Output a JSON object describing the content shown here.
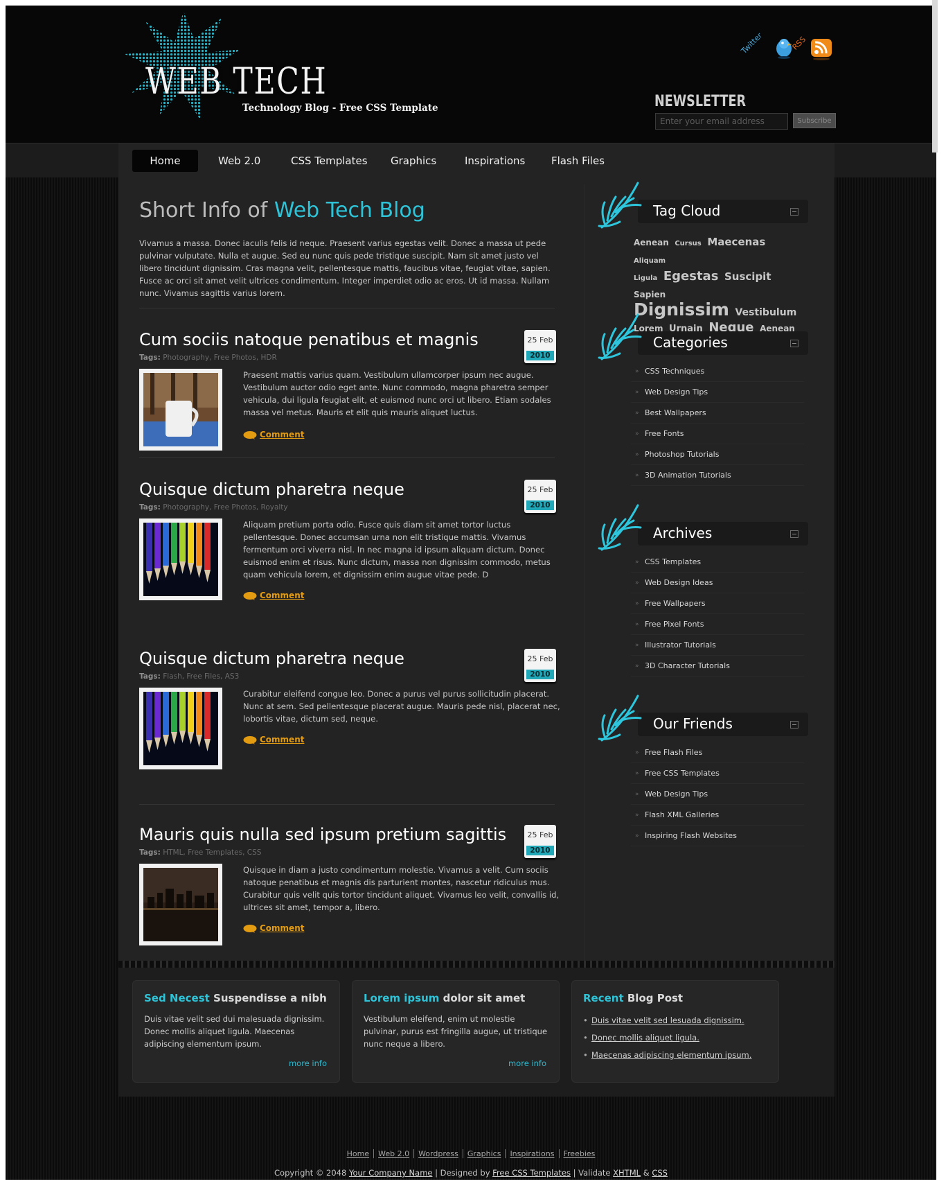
{
  "header": {
    "logo_title": "WEB TECH",
    "logo_subtitle": "Technology Blog - Free CSS Template",
    "social": {
      "twitter_label": "Twitter",
      "rss_label": "RSS"
    },
    "newsletter": {
      "title": "NEWSLETTER",
      "placeholder": "Enter your email address",
      "button_label": "Subscribe"
    }
  },
  "nav": {
    "items": [
      {
        "label": "Home",
        "active": true
      },
      {
        "label": "Web 2.0"
      },
      {
        "label": "CSS Templates"
      },
      {
        "label": "Graphics"
      },
      {
        "label": "Inspirations"
      },
      {
        "label": "Flash Files"
      }
    ]
  },
  "intro": {
    "title_plain": "Short Info of ",
    "title_accent": "Web Tech Blog",
    "text": "Vivamus a massa. Donec iaculis felis id neque. Praesent varius egestas velit. Donec a massa ut pede pulvinar vulputate. Nulla et augue. Sed eu nunc quis pede tristique suscipit. Nam sit amet justo vel libero tincidunt dignissim. Cras magna velit, pellentesque mattis, faucibus vitae, feugiat vitae, sapien. Fusce ac orci sit amet velit ultrices condimentum. Integer imperdiet odio ac eros. Ut id massa. Nullam nunc. Vivamus sagittis varius lorem."
  },
  "posts": [
    {
      "title": "Cum sociis natoque penatibus et magnis",
      "tags_label": "Tags:",
      "tags": "Photography, Free Photos, HDR",
      "date_day": "25 Feb",
      "date_year": "2010",
      "body": "Praesent mattis varius quam. Vestibulum ullamcorper ipsum nec augue. Vestibulum auctor odio eget ante. Nunc commodo, magna pharetra semper vehicula, dui ligula feugiat elit, et euismod nunc orci ut libero. Etiam sodales massa vel metus. Mauris et elit quis mauris aliquet luctus.",
      "comment_label": "Comment",
      "image": "coffee-cup-photo"
    },
    {
      "title": "Quisque dictum pharetra neque",
      "tags_label": "Tags:",
      "tags": "Photography, Free Photos, Royalty",
      "date_day": "25 Feb",
      "date_year": "2010",
      "body": "Aliquam pretium porta odio. Fusce quis diam sit amet tortor luctus pellentesque. Donec accumsan urna non elit tristique mattis. Vivamus fermentum orci viverra nisl. In nec magna id ipsum aliquam dictum. Donec euismod enim et risus. Nunc dictum, massa non dignissim commodo, metus quam vehicula lorem, et dignissim enim augue vitae pede. D",
      "comment_label": "Comment",
      "image": "colored-pencils-photo"
    },
    {
      "title": "Quisque dictum pharetra neque",
      "tags_label": "Tags:",
      "tags": "Flash, Free Files, AS3",
      "date_day": "25 Feb",
      "date_year": "2010",
      "body": "Curabitur eleifend congue leo. Donec a purus vel purus sollicitudin placerat. Nunc at sem. Sed pellentesque placerat augue. Mauris pede nisl, placerat nec, lobortis vitae, dictum sed, neque.",
      "comment_label": "Comment",
      "image": "colored-pencils-photo"
    },
    {
      "title": "Mauris quis nulla sed ipsum pretium sagittis",
      "tags_label": "Tags:",
      "tags": "HTML, Free Templates, CSS",
      "date_day": "25 Feb",
      "date_year": "2010",
      "body": "Quisque in diam a justo condimentum molestie. Vivamus a velit. Cum sociis natoque penatibus et magnis dis parturient montes, nascetur ridiculus mus. Curabitur quis velit quis tortor tincidunt aliquet. Vivamus leo velit, convallis id, ultrices sit amet, tempor a, libero.",
      "comment_label": "Comment",
      "image": "city-skyline-photo"
    }
  ],
  "sidebar": {
    "tag_cloud": {
      "title": "Tag Cloud",
      "tags": [
        {
          "text": "Aenean",
          "size": "small"
        },
        {
          "text": "Cursus",
          "size": "xsmall"
        },
        {
          "text": "Maecenas",
          "size": "medium"
        },
        {
          "text": "Aliquam",
          "size": "xsmall"
        },
        {
          "text": "Ligula",
          "size": "xsmall"
        },
        {
          "text": "Egestas",
          "size": "large"
        },
        {
          "text": "Suscipit",
          "size": "medium"
        },
        {
          "text": "Sapien",
          "size": "small"
        },
        {
          "text": "Dignissim",
          "size": "xlarge"
        },
        {
          "text": "Vestibulum",
          "size": "medium"
        },
        {
          "text": "Lorem",
          "size": "small"
        },
        {
          "text": "Urnain",
          "size": "small-medium"
        },
        {
          "text": "Neque",
          "size": "large"
        },
        {
          "text": "Aenean",
          "size": "small"
        }
      ]
    },
    "categories": {
      "title": "Categories",
      "items": [
        "CSS Techniques",
        "Web Design Tips",
        "Best Wallpapers",
        "Free Fonts",
        "Photoshop Tutorials",
        "3D Animation Tutorials"
      ]
    },
    "archives": {
      "title": "Archives",
      "items": [
        "CSS Templates",
        "Web Design Ideas",
        "Free Wallpapers",
        "Free Pixel Fonts",
        "Illustrator Tutorials",
        "3D Character Tutorials"
      ]
    },
    "friends": {
      "title": "Our Friends",
      "items": [
        "Free Flash Files",
        "Free CSS Templates",
        "Web Design Tips",
        "Flash XML Galleries",
        "Inspiring Flash Websites"
      ]
    }
  },
  "footer_boxes": [
    {
      "title_accent": "Sed Necest",
      "title_plain": " Suspendisse a nibh",
      "text": "Duis vitae velit sed dui malesuada dignissim. Donec mollis aliquet ligula. Maecenas adipiscing elementum ipsum.",
      "more": "more info"
    },
    {
      "title_accent": "Lorem ipsum",
      "title_plain": " dolor sit amet",
      "text": "Vestibulum eleifend, enim ut molestie pulvinar, purus est fringilla augue, ut tristique nunc neque a libero.",
      "more": "more info"
    },
    {
      "title_accent": "Recent",
      "title_plain": " Blog Post",
      "links": [
        "Duis vitae velit sed lesuada dignissim.",
        "Donec mollis aliquet ligula.",
        "Maecenas adipiscing elementum ipsum."
      ]
    }
  ],
  "footer": {
    "links": [
      "Home",
      "Web 2.0",
      "Wordpress",
      "Graphics",
      "Inspirations",
      "Freebies"
    ],
    "copyright_prefix": "Copyright © 2048",
    "company": "Your Company Name",
    "designed_by_prefix": "| Designed by",
    "designer": "Free CSS Templates",
    "validate_prefix": "| Validate",
    "xhtml": "XHTML",
    "amp": "&",
    "css": "CSS"
  },
  "colors": {
    "accent": "#2fc3d7",
    "comment": "#e39b12",
    "background": "#232323"
  }
}
